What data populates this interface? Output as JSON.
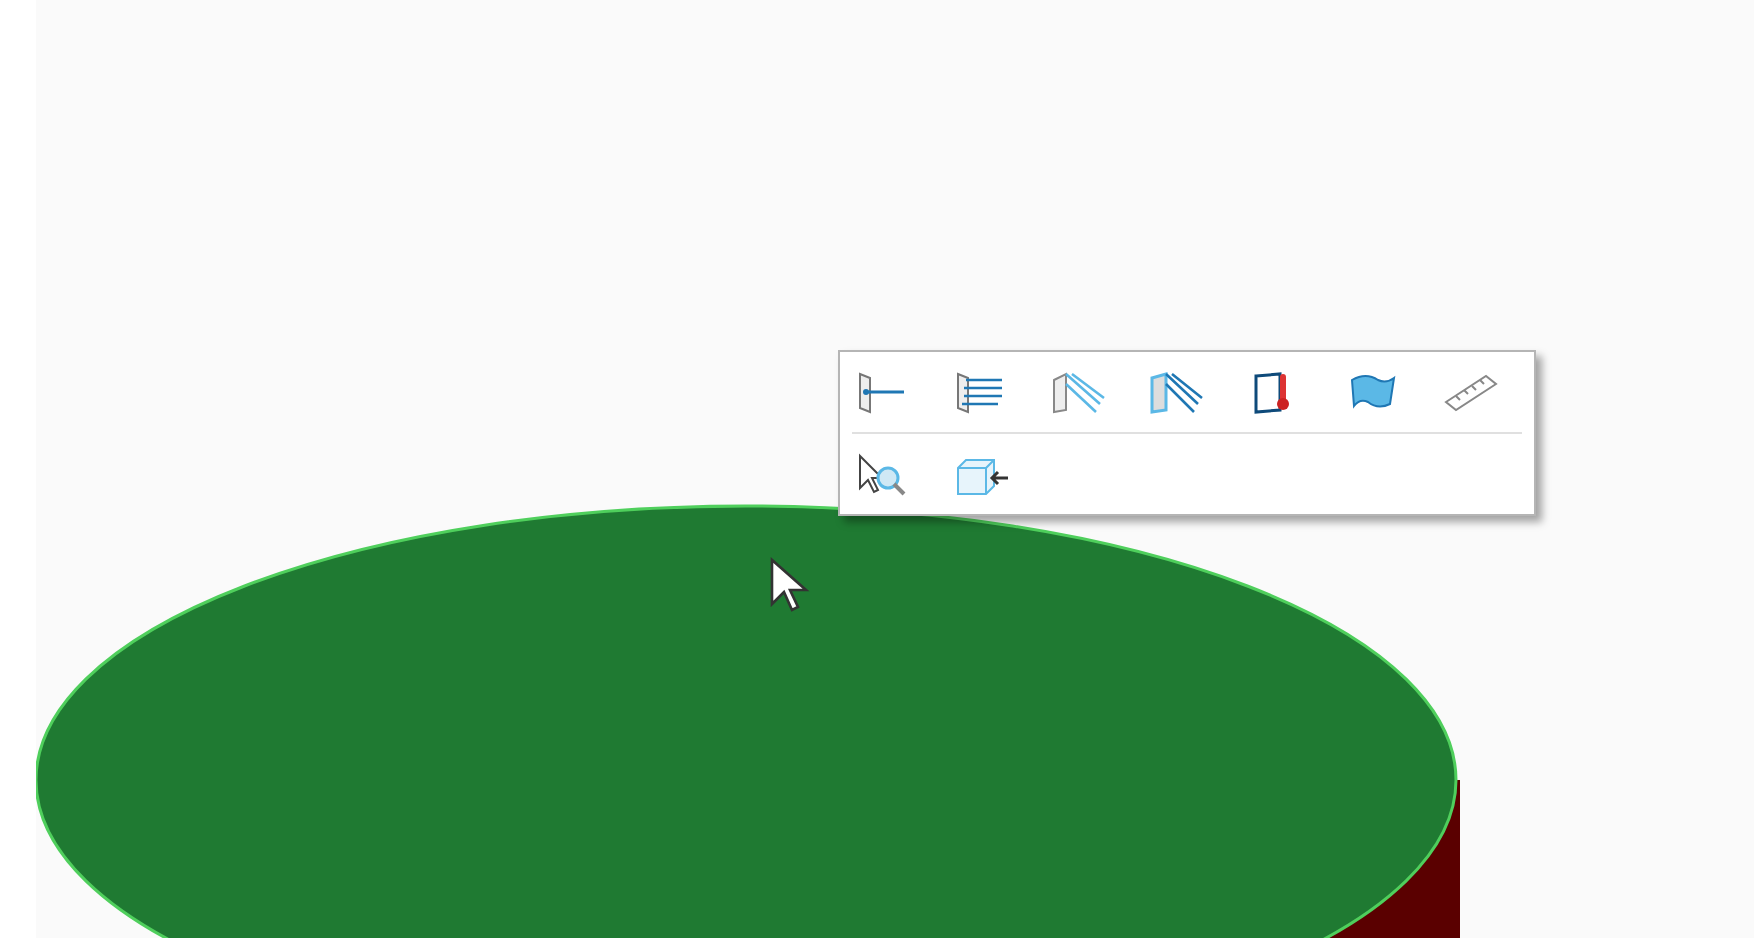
{
  "toolbar": {
    "rows": [
      {
        "items": [
          {
            "kind": "force"
          },
          {
            "kind": "pressure"
          },
          {
            "kind": "flow"
          },
          {
            "kind": "outflow"
          },
          {
            "kind": "temperature"
          },
          {
            "kind": "surface"
          },
          {
            "kind": "ruler"
          }
        ]
      },
      {
        "items": [
          {
            "kind": "inspect"
          },
          {
            "kind": "constraint"
          }
        ]
      }
    ]
  }
}
